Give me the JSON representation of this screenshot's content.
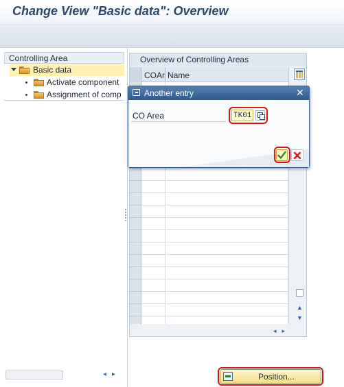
{
  "window": {
    "title": "Change View \"Basic data\": Overview"
  },
  "tree": {
    "header": "Controlling Area",
    "items": [
      {
        "label": "Basic data",
        "selected": true
      },
      {
        "label": "Activate component"
      },
      {
        "label": "Assignment of comp"
      }
    ]
  },
  "table": {
    "panel_title": "Overview of Controlling Areas",
    "columns": [
      "COAr",
      "Name"
    ]
  },
  "dialog": {
    "title": "Another entry",
    "field_label": "CO Area",
    "field_value": "TK01"
  },
  "buttons": {
    "position_label": "Position..."
  },
  "colors": {
    "title": "#2d4769",
    "highlight_ring": "#d0191a",
    "dialog_header": "#2f5a8e",
    "selection": "#fff2b3"
  },
  "icons": [
    "folder-icon",
    "expand-triangle-icon",
    "table-settings-icon",
    "dialog-entry-icon",
    "close-icon",
    "value-help-icon",
    "checkmark-icon",
    "cancel-x-icon",
    "position-icon",
    "scroll-up-icon",
    "scroll-down-icon"
  ]
}
